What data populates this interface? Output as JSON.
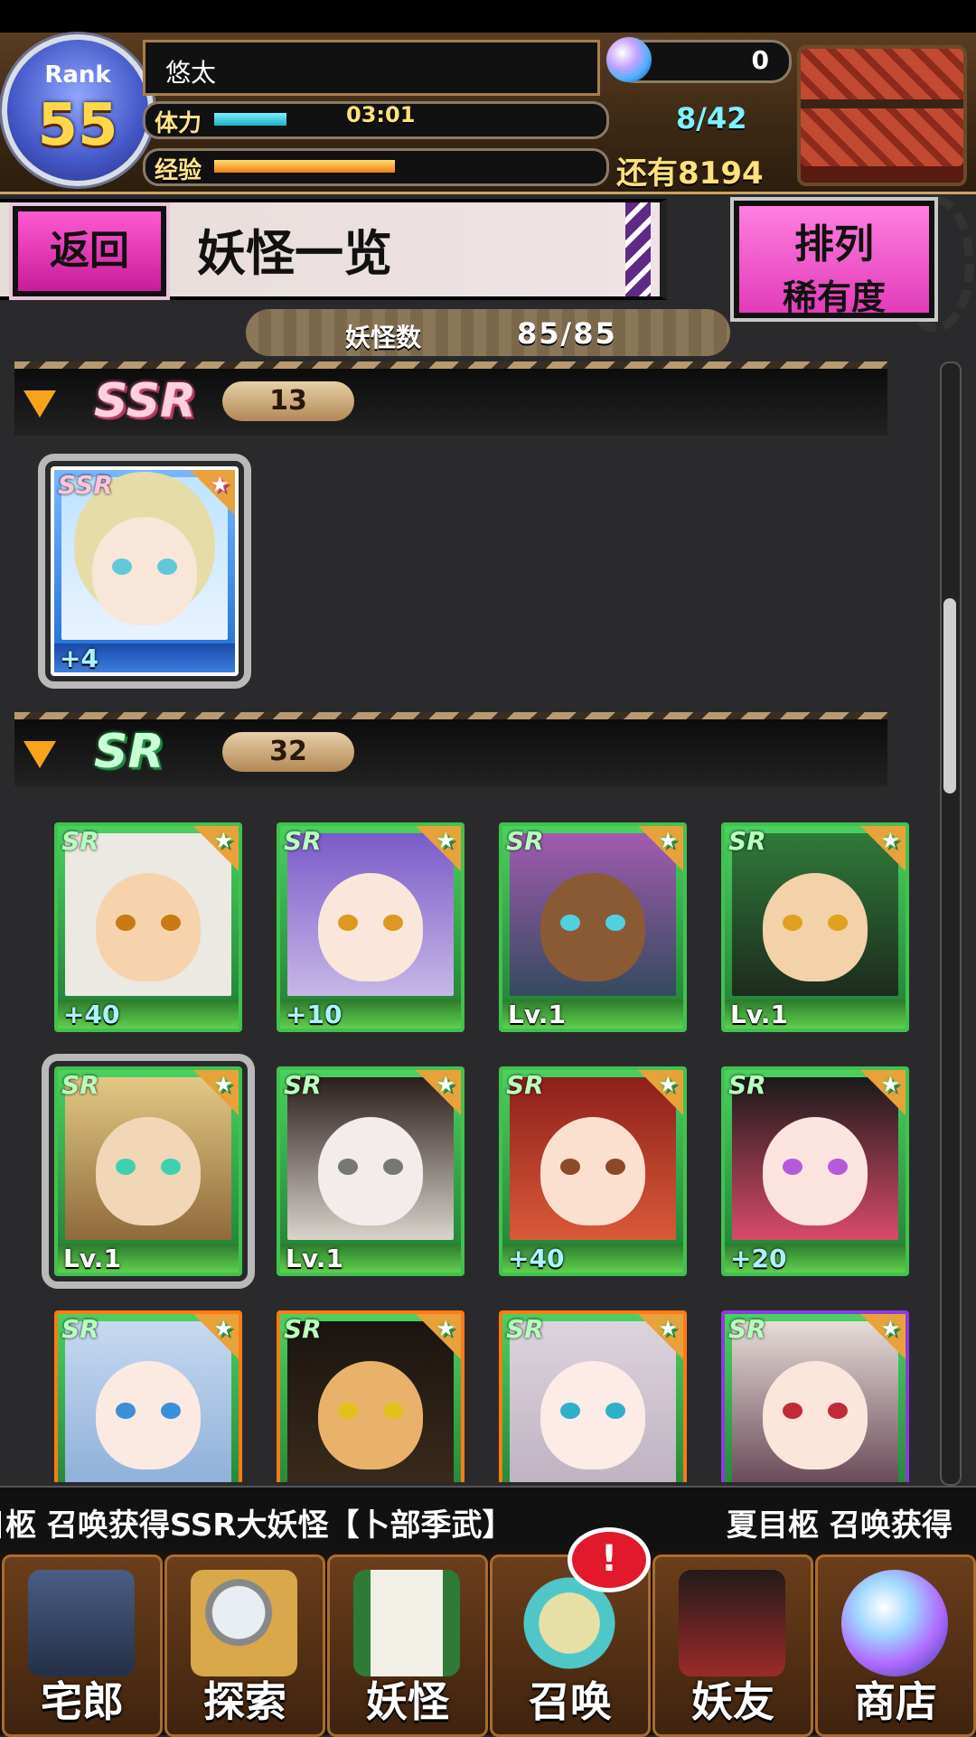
{
  "player": {
    "rank_label": "Rank",
    "rank": "55",
    "name": "悠太",
    "stamina_label": "体力",
    "stamina_timer": "03:01",
    "exp_label": "经验",
    "gems": "0",
    "capacity": "8/42",
    "exp_remaining": "还有8194"
  },
  "title_bar": {
    "back_label": "返回",
    "title": "妖怪一览",
    "sort_label_top": "排列",
    "sort_label_bottom": "稀有度"
  },
  "count": {
    "label": "妖怪数",
    "value": "85/85"
  },
  "sections": [
    {
      "rarity": "SSR",
      "count": "13",
      "cards": [
        {
          "badge": "SSR",
          "level": "+4"
        }
      ]
    },
    {
      "rarity": "SR",
      "count": "32",
      "cards": [
        {
          "badge": "SR",
          "level": "+40"
        },
        {
          "badge": "SR",
          "level": "+10"
        },
        {
          "badge": "SR",
          "level": "Lv.1"
        },
        {
          "badge": "SR",
          "level": "Lv.1"
        },
        {
          "badge": "SR",
          "level": "Lv.1"
        },
        {
          "badge": "SR",
          "level": "Lv.1"
        },
        {
          "badge": "SR",
          "level": "+40"
        },
        {
          "badge": "SR",
          "level": "+20"
        },
        {
          "badge": "SR",
          "level": ""
        },
        {
          "badge": "SR",
          "level": ""
        },
        {
          "badge": "SR",
          "level": ""
        },
        {
          "badge": "SR",
          "level": ""
        }
      ]
    }
  ],
  "ticker": {
    "text1": "目柩 召唤获得SSR大妖怪【卜部季武】",
    "text2": "夏目柩 召唤获得"
  },
  "nav": [
    {
      "label": "宅郎",
      "icon": "house-icon"
    },
    {
      "label": "探索",
      "icon": "magnifier-map-icon"
    },
    {
      "label": "妖怪",
      "icon": "scroll-icon"
    },
    {
      "label": "召唤",
      "icon": "summon-star-icon"
    },
    {
      "label": "妖友",
      "icon": "friend-icon"
    },
    {
      "label": "商店",
      "icon": "crystal-ball-icon"
    }
  ],
  "notification_mark": "!",
  "colors": {
    "accent_pink": "#e23cb9",
    "ssr_blue": "#1b6bd6",
    "sr_green": "#41c24e"
  }
}
